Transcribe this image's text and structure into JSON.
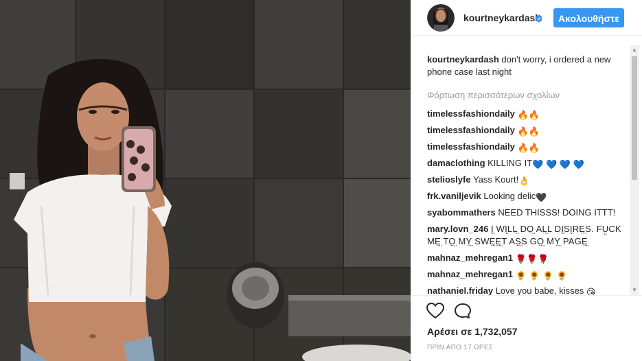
{
  "post": {
    "username": "kourtneykardash",
    "follow_label": "Ακολουθήστε",
    "caption_user": "kourtneykardash",
    "caption_text": "don't worry, i ordered a new phone case last night",
    "load_more": "Φόρτωση περισσότερων σχολίων"
  },
  "comments": [
    {
      "user": "timelessfashiondaily",
      "text": "",
      "emoji": "fire-fire"
    },
    {
      "user": "timelessfashiondaily",
      "text": "",
      "emoji": "fire-fire"
    },
    {
      "user": "timelessfashiondaily",
      "text": "",
      "emoji": "fire-fire"
    },
    {
      "user": "damaclothing",
      "text": "KILLING IT",
      "emoji": "blue-hearts-4"
    },
    {
      "user": "stelioslyfe",
      "text": "Yass Kourt!",
      "emoji": "ok-hand"
    },
    {
      "user": "frk.vaniljevik",
      "text": "Looking delic",
      "emoji": "black-heart"
    },
    {
      "user": "syabommathers",
      "text": "NEED THISSS! DOING ITTT!",
      "emoji": ""
    },
    {
      "user": "mary.lovn_246",
      "text": "I̤̤ WI̤̤LL̤̤ DO̤̤ AL̤̤L DI̤̤SI̤̤RE̤̤S. FṲ̤CK ME̤̤ TO̤̤ MY̤̤ SWE̤̤E̤̤T AS̤̤S GO̤̤ MY̤̤ PAGE̤̤",
      "emoji": ""
    },
    {
      "user": "mahnaz_mehregan1",
      "text": "",
      "emoji": "roses-3"
    },
    {
      "user": "mahnaz_mehregan1",
      "text": "",
      "emoji": "sunflowers-4"
    },
    {
      "user": "nathaniel.friday",
      "text": "Love you babe, kisses",
      "emoji": "kiss-face"
    }
  ],
  "likes_label": "Αρέσει σε 1,732,057",
  "timestamp": "ΠΡΙΝ ΑΠΟ 17 ΩΡΕΣ",
  "icons": {
    "verified": "verified-badge-icon",
    "like": "heart-outline-icon",
    "comment": "speech-bubble-icon"
  },
  "colors": {
    "accent": "#3897f0",
    "muted": "#999999",
    "text": "#262626"
  }
}
